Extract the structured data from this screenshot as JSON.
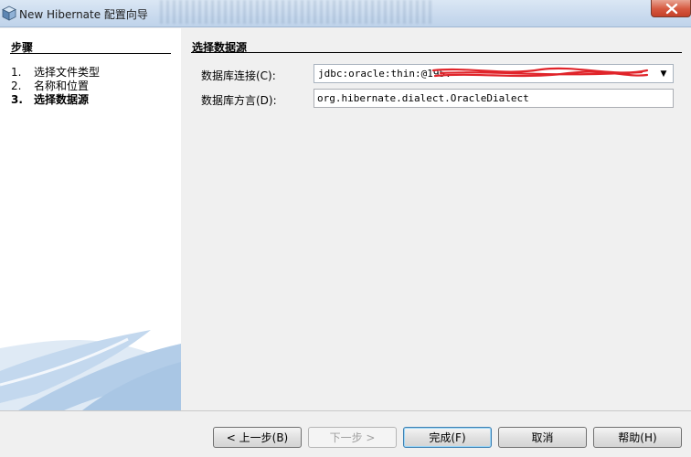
{
  "window": {
    "title": "New Hibernate 配置向导",
    "icon": "netbeans-cube-icon",
    "close_icon": "close-icon"
  },
  "steps": {
    "heading": "步骤",
    "items": [
      {
        "num": "1.",
        "label": "选择文件类型",
        "current": false
      },
      {
        "num": "2.",
        "label": "名称和位置",
        "current": false
      },
      {
        "num": "3.",
        "label": "选择数据源",
        "current": true
      }
    ]
  },
  "main": {
    "heading": "选择数据源",
    "connection": {
      "label": "数据库连接(C):",
      "value": "jdbc:oracle:thin:@195.",
      "redacted": true
    },
    "dialect": {
      "label": "数据库方言(D):",
      "value": "org.hibernate.dialect.OracleDialect"
    }
  },
  "buttons": {
    "back": "< 上一步(B)",
    "next": "下一步 >",
    "finish": "完成(F)",
    "cancel": "取消",
    "help": "帮助(H)"
  },
  "colors": {
    "titlebar": "#c9daee",
    "close_button": "#d5583f",
    "redaction": "#e0242a",
    "swoosh": "#b9d2ea"
  }
}
